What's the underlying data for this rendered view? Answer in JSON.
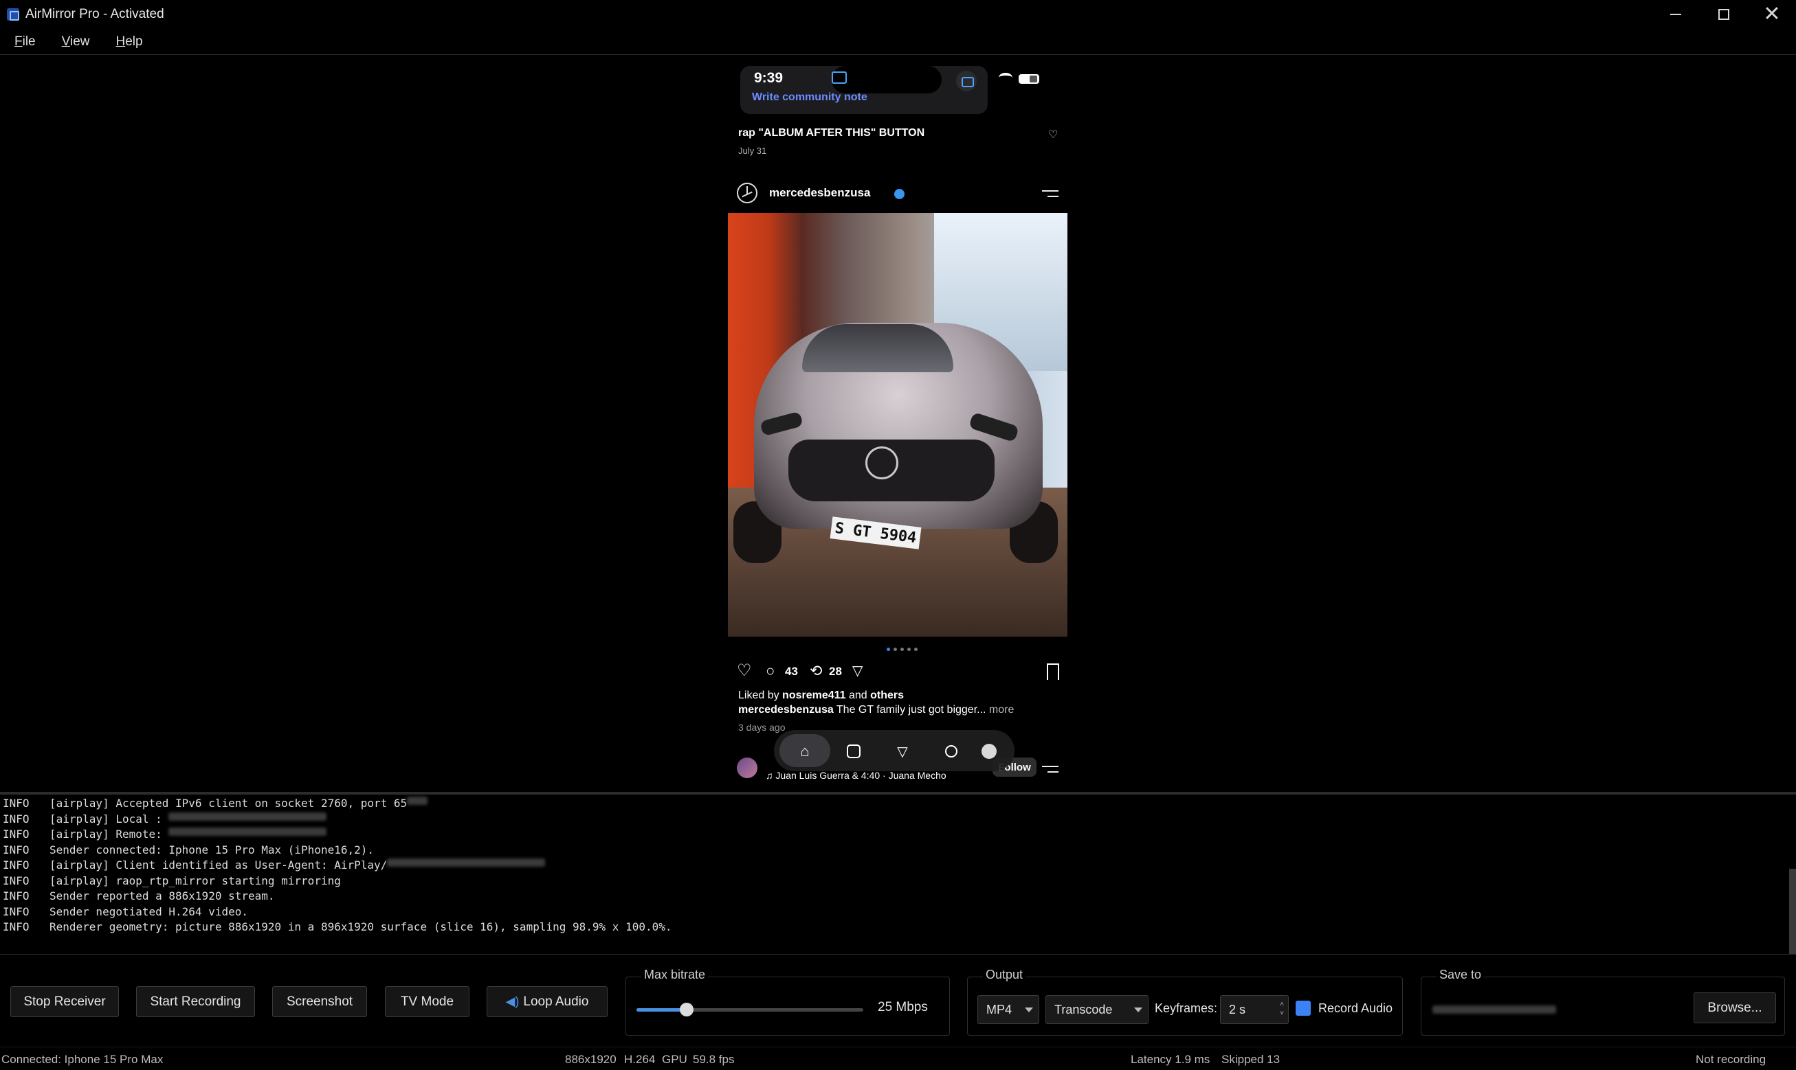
{
  "window": {
    "title": "AirMirror Pro - Activated",
    "controls": {
      "minimize": "—",
      "maximize": "☐",
      "close": "✕"
    }
  },
  "menu": {
    "items": [
      {
        "first": "F",
        "rest": "ile"
      },
      {
        "first": "V",
        "rest": "iew"
      },
      {
        "first": "H",
        "rest": "elp"
      }
    ]
  },
  "phone": {
    "status_time": "9:39",
    "community_note": "Write community note",
    "prev_post": {
      "title": "rap \"ALBUM AFTER THIS\" BUTTON",
      "date": "July 31"
    },
    "post": {
      "author": "mercedesbenzusa",
      "plate": "S GT 5904",
      "comments": "43",
      "reposts": "28",
      "liked_prefix": "Liked by ",
      "liked_user": "nosreme411",
      "liked_mid": " and ",
      "liked_others": "others",
      "caption_user": "mercedesbenzusa",
      "caption_text": " The GT family just got bigger... ",
      "caption_more": "more",
      "time_ago": "3 days ago",
      "carousel_pages": 5,
      "carousel_active": 1
    },
    "next_post": {
      "music": "♫ Juan Luis Guerra & 4:40 · Juana Mecho",
      "follow_label": "Follow"
    },
    "tabbar_icons": [
      "home-icon",
      "reels-icon",
      "send-icon",
      "search-icon",
      "profile-icon"
    ]
  },
  "log": {
    "lines": [
      {
        "level": "INFO",
        "text": "[airplay] Accepted IPv6 client on socket 2760, port 65",
        "redacted": true
      },
      {
        "level": "INFO",
        "text": "[airplay] Local : ",
        "redacted": true
      },
      {
        "level": "INFO",
        "text": "[airplay] Remote: ",
        "redacted": true
      },
      {
        "level": "INFO",
        "text": "Sender connected: Iphone 15 Pro Max (iPhone16,2).",
        "redacted": false
      },
      {
        "level": "INFO",
        "text": "[airplay] Client identified as User-Agent: AirPlay/",
        "redacted": true
      },
      {
        "level": "INFO",
        "text": "[airplay] raop_rtp_mirror starting mirroring",
        "redacted": false
      },
      {
        "level": "INFO",
        "text": "Sender reported a 886x1920 stream.",
        "redacted": false
      },
      {
        "level": "INFO",
        "text": "Sender negotiated H.264 video.",
        "redacted": false
      },
      {
        "level": "INFO",
        "text": "Renderer geometry: picture 886x1920 in a 896x1920 surface (slice 16), sampling 98.9% x 100.0%.",
        "redacted": false
      }
    ]
  },
  "controls": {
    "stop_receiver": "Stop Receiver",
    "start_recording": "Start Recording",
    "screenshot": "Screenshot",
    "tv_mode": "TV Mode",
    "loop_audio": "Loop Audio",
    "bitrate": {
      "title": "Max bitrate",
      "value_label": "25 Mbps",
      "fraction": 0.22
    },
    "output": {
      "title": "Output",
      "format": "MP4",
      "mode": "Transcode",
      "keyframes_label": "Keyframes:",
      "keyframes_value": "2 s",
      "record_audio_label": "Record Audio",
      "record_audio_checked": true
    },
    "save": {
      "title": "Save to",
      "browse": "Browse..."
    },
    "accent_color": "#3b82f6"
  },
  "status": {
    "connected": "Connected: Iphone 15 Pro Max",
    "resolution": "886x1920",
    "codec": "H.264",
    "gpu": "GPU",
    "fps": "59.8 fps",
    "latency": "Latency 1.9 ms",
    "skipped": "Skipped 13",
    "recording": "Not recording"
  }
}
